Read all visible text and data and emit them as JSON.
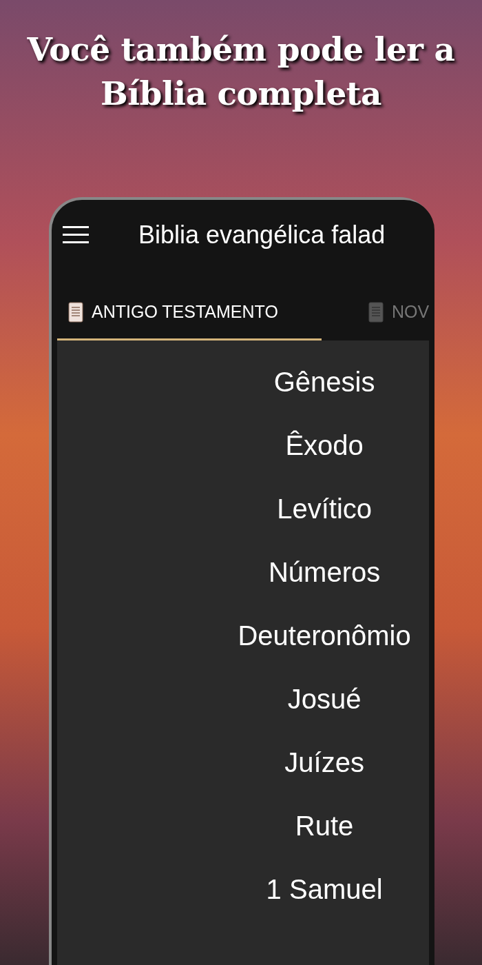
{
  "headline": "Você também pode ler a Bíblia completa",
  "app_bar": {
    "title": "Biblia evangélica falad"
  },
  "tabs": [
    {
      "label": "ANTIGO TESTAMENTO",
      "selected": true
    },
    {
      "label": "NOV",
      "selected": false
    }
  ],
  "books": [
    "Gênesis",
    "Êxodo",
    "Levítico",
    "Números",
    "Deuteronômio",
    "Josué",
    "Juízes",
    "Rute",
    "1 Samuel"
  ]
}
